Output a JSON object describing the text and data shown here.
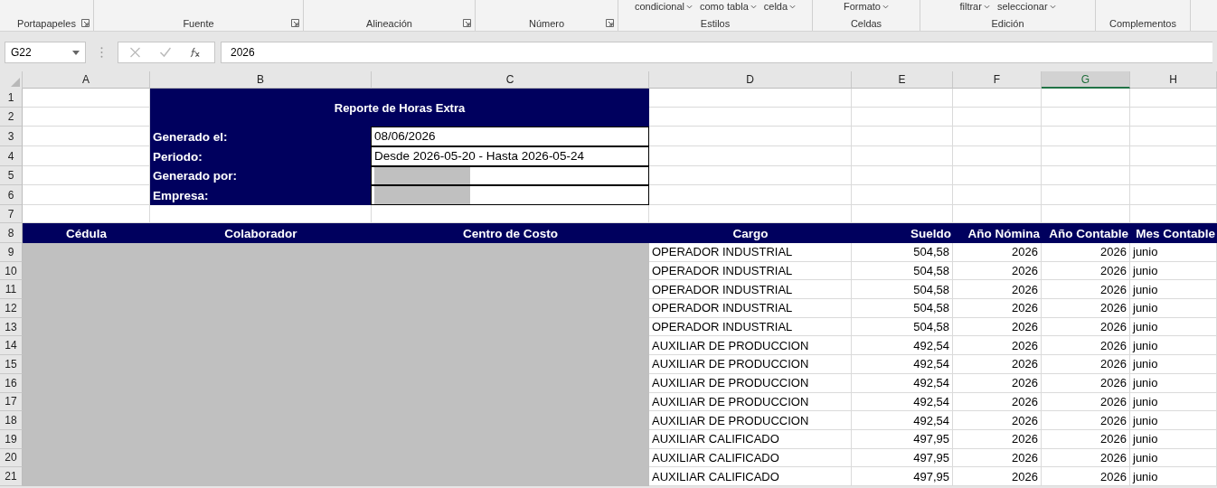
{
  "ribbon": {
    "groups": [
      {
        "label": "Portapapeles",
        "launcher": true
      },
      {
        "label": "Fuente",
        "launcher": true
      },
      {
        "label": "Alineación",
        "launcher": true
      },
      {
        "label": "Número",
        "launcher": true
      },
      {
        "label": "Estilos",
        "items": [
          "condicional",
          "como tabla",
          "celda"
        ],
        "launcher": false
      },
      {
        "label": "Celdas",
        "items": [
          "Formato"
        ],
        "launcher": false
      },
      {
        "label": "Edición",
        "items": [
          "filtrar",
          "seleccionar"
        ],
        "launcher": false
      },
      {
        "label": "Complementos",
        "launcher": false
      }
    ]
  },
  "formula_bar": {
    "name_box": "G22",
    "value": "2026"
  },
  "columns": [
    {
      "label": "A",
      "selected": false
    },
    {
      "label": "B",
      "selected": false
    },
    {
      "label": "C",
      "selected": false
    },
    {
      "label": "D",
      "selected": false
    },
    {
      "label": "E",
      "selected": false
    },
    {
      "label": "F",
      "selected": false
    },
    {
      "label": "G",
      "selected": true
    },
    {
      "label": "H",
      "selected": false
    }
  ],
  "row_numbers": [
    "1",
    "2",
    "3",
    "4",
    "5",
    "6",
    "7",
    "8",
    "9",
    "10",
    "11",
    "12",
    "13",
    "14",
    "15",
    "16",
    "17",
    "18",
    "19",
    "20",
    "21"
  ],
  "report": {
    "title": "Reporte de Horas Extra",
    "info": [
      {
        "label": "Generado el:",
        "kind": "text",
        "value": "08/06/2026"
      },
      {
        "label": "Periodo:",
        "kind": "text",
        "value": "Desde 2026-05-20 - Hasta 2026-05-24"
      },
      {
        "label": "Generado por:",
        "kind": "redacted"
      },
      {
        "label": "Empresa:",
        "kind": "redacted"
      }
    ]
  },
  "table": {
    "columns": [
      "Cédula",
      "Colaborador",
      "Centro de Costo",
      "Cargo",
      "Sueldo",
      "Año Nómina",
      "Año Contable",
      "Mes Contable"
    ],
    "rows": [
      {
        "cargo": "OPERADOR INDUSTRIAL",
        "sueldo": "504,58",
        "ano_nomina": "2026",
        "ano_contable": "2026",
        "mes_contable": "junio"
      },
      {
        "cargo": "OPERADOR INDUSTRIAL",
        "sueldo": "504,58",
        "ano_nomina": "2026",
        "ano_contable": "2026",
        "mes_contable": "junio"
      },
      {
        "cargo": "OPERADOR INDUSTRIAL",
        "sueldo": "504,58",
        "ano_nomina": "2026",
        "ano_contable": "2026",
        "mes_contable": "junio"
      },
      {
        "cargo": "OPERADOR INDUSTRIAL",
        "sueldo": "504,58",
        "ano_nomina": "2026",
        "ano_contable": "2026",
        "mes_contable": "junio"
      },
      {
        "cargo": "OPERADOR INDUSTRIAL",
        "sueldo": "504,58",
        "ano_nomina": "2026",
        "ano_contable": "2026",
        "mes_contable": "junio"
      },
      {
        "cargo": "AUXILIAR DE PRODUCCION",
        "sueldo": "492,54",
        "ano_nomina": "2026",
        "ano_contable": "2026",
        "mes_contable": "junio"
      },
      {
        "cargo": "AUXILIAR DE PRODUCCION",
        "sueldo": "492,54",
        "ano_nomina": "2026",
        "ano_contable": "2026",
        "mes_contable": "junio"
      },
      {
        "cargo": "AUXILIAR DE PRODUCCION",
        "sueldo": "492,54",
        "ano_nomina": "2026",
        "ano_contable": "2026",
        "mes_contable": "junio"
      },
      {
        "cargo": "AUXILIAR DE PRODUCCION",
        "sueldo": "492,54",
        "ano_nomina": "2026",
        "ano_contable": "2026",
        "mes_contable": "junio"
      },
      {
        "cargo": "AUXILIAR DE PRODUCCION",
        "sueldo": "492,54",
        "ano_nomina": "2026",
        "ano_contable": "2026",
        "mes_contable": "junio"
      },
      {
        "cargo": "AUXILIAR CALIFICADO",
        "sueldo": "497,95",
        "ano_nomina": "2026",
        "ano_contable": "2026",
        "mes_contable": "junio"
      },
      {
        "cargo": "AUXILIAR CALIFICADO",
        "sueldo": "497,95",
        "ano_nomina": "2026",
        "ano_contable": "2026",
        "mes_contable": "junio"
      },
      {
        "cargo": "AUXILIAR CALIFICADO",
        "sueldo": "497,95",
        "ano_nomina": "2026",
        "ano_contable": "2026",
        "mes_contable": "junio"
      }
    ]
  }
}
